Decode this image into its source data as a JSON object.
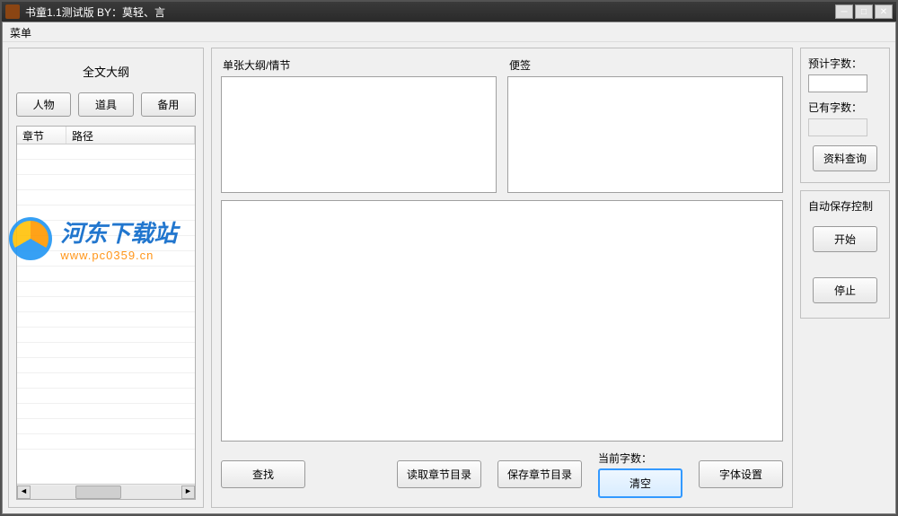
{
  "titlebar": {
    "text": "书童1.1测试版    BY：莫轻、言"
  },
  "menubar": {
    "menu": "菜单"
  },
  "left": {
    "title": "全文大纲",
    "btn_character": "人物",
    "btn_item": "道具",
    "btn_spare": "备用",
    "col_chapter": "章节",
    "col_path": "路径"
  },
  "center": {
    "outline_label": "单张大纲/情节",
    "note_label": "便签",
    "btn_find": "查找",
    "btn_load_toc": "读取章节目录",
    "btn_save_toc": "保存章节目录",
    "current_words_label": "当前字数：",
    "btn_clear": "清空",
    "btn_font": "字体设置"
  },
  "right": {
    "expected_label": "预计字数：",
    "existing_label": "已有字数：",
    "btn_query": "资料查询",
    "autosave_label": "自动保存控制",
    "btn_start": "开始",
    "btn_stop": "停止"
  },
  "watermark": {
    "cn": "河东下载站",
    "url": "www.pc0359.cn"
  }
}
